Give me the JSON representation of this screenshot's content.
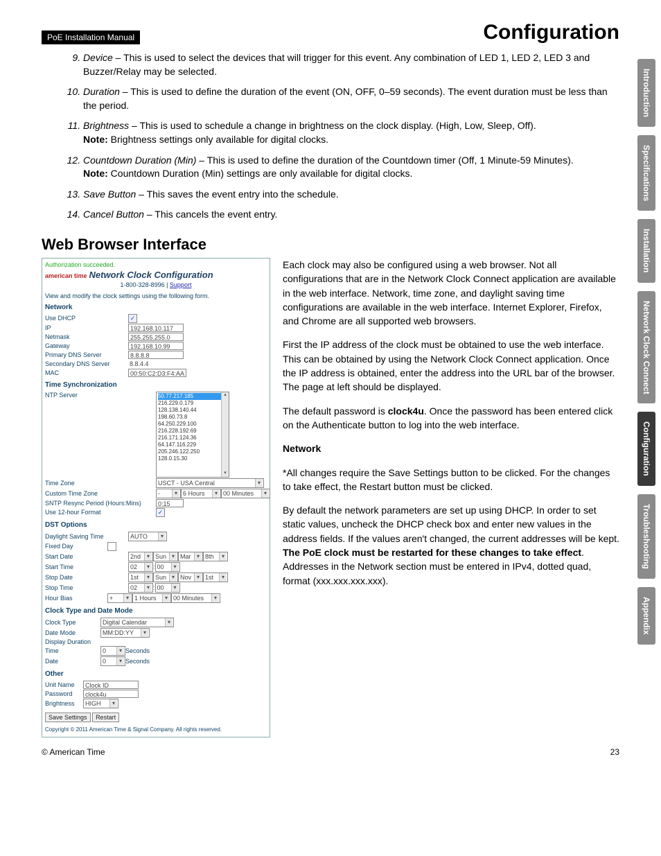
{
  "header": {
    "manual_tag": "PoE Installation Manual",
    "page_title": "Configuration"
  },
  "list": {
    "start": 9,
    "items": [
      {
        "term": "Device",
        "body": " – This is used to select the devices that will trigger for this event. Any combination of LED 1, LED 2, LED 3 and Buzzer/Relay may be selected."
      },
      {
        "term": "Duration",
        "body": " – This is used to define the duration of the event (ON, OFF, 0–59 seconds). The event duration must be less than the period."
      },
      {
        "term": "Brightness",
        "body": " – This is used to schedule a change in brightness on the clock display. (High, Low, Sleep, Off).",
        "note": "Brightness settings only available for digital clocks."
      },
      {
        "term": "Countdown Duration (Min)",
        "body": " – This is used to define the duration of the Countdown timer (Off, 1 Minute-59 Minutes).",
        "note": "Countdown Duration (Min) settings are only available for digital clocks."
      },
      {
        "term": "Save Button",
        "body": " – This saves the event entry into the schedule."
      },
      {
        "term": "Cancel Button",
        "body": " – This cancels the event entry."
      }
    ],
    "note_label": "Note:"
  },
  "section_heading": "Web Browser Interface",
  "screenshot": {
    "auth": "Authorization succeeded.",
    "brand_logo": "american time",
    "brand_title": "Network Clock Configuration",
    "support": "1-800-328-8996 | ",
    "support_link": "Support",
    "desc": "View and modify the clock settings using the following form.",
    "sec_network": "Network",
    "net": {
      "use_dhcp_label": "Use DHCP",
      "use_dhcp_check": "✓",
      "ip_label": "IP",
      "ip": "192.168.10.117",
      "netmask_label": "Netmask",
      "netmask": "255.255.255.0",
      "gateway_label": "Gateway",
      "gateway": "192.168.10.99",
      "pdns_label": "Primary DNS Server",
      "pdns": "8.8.8.8",
      "sdns_label": "Secondary DNS Server",
      "sdns": "8.8.4.4",
      "mac_label": "MAC",
      "mac": "00:50:C2:D3:F4:AA"
    },
    "sec_time": "Time Synchronization",
    "time": {
      "ntp_label": "NTP Server",
      "ntp_list": [
        "50.77.217.185",
        "216.229.0.179",
        "128.138.140.44",
        "198.60.73.8",
        "64.250.229.100",
        "216.228.192.69",
        "216.171.124.36",
        "64.147.116.229",
        "205.246.122.250",
        "128.0.15.30"
      ],
      "tz_label": "Time Zone",
      "tz": "USCT - USA Central",
      "ctz_label": "Custom Time Zone",
      "ctz_sign": "-",
      "ctz_hours": "6 Hours",
      "ctz_mins": "00 Minutes",
      "resync_label": "SNTP Resync Period (Hours:Mins)",
      "resync": "0:15",
      "h12_label": "Use 12-hour Format",
      "h12_check": "✓"
    },
    "sec_dst": "DST Options",
    "dst": {
      "dst_label": "Daylight Saving Time",
      "dst_mode": "AUTO",
      "fixed_label": "Fixed Day",
      "start_date_label": "Start Date",
      "sd1": "2nd",
      "sd2": "Sun",
      "sd3": "Mar",
      "sd4": "8th",
      "start_time_label": "Start Time",
      "st1": "02",
      "st2": "00",
      "stop_date_label": "Stop Date",
      "ed1": "1st",
      "ed2": "Sun",
      "ed3": "Nov",
      "ed4": "1st",
      "stop_time_label": "Stop Time",
      "et1": "02",
      "et2": "00",
      "hour_bias_label": "Hour Bias",
      "hb1": "+",
      "hb2": "1 Hours",
      "hb3": "00 Minutes"
    },
    "sec_clock": "Clock Type and Date Mode",
    "clock": {
      "type_label": "Clock Type",
      "type": "Digital Calendar",
      "mode_label": "Date Mode",
      "mode": "MM:DD:YY",
      "disp_label": "Display Duration",
      "time_label": "Time",
      "time_val": "0",
      "time_unit": "Seconds",
      "date_label": "Date",
      "date_val": "0",
      "date_unit": "Seconds"
    },
    "sec_other": "Other",
    "other": {
      "unit_label": "Unit Name",
      "unit": "Clock ID",
      "pw_label": "Password",
      "pw": "clock4u",
      "bright_label": "Brightness",
      "bright": "HIGH"
    },
    "btn_save": "Save Settings",
    "btn_restart": "Restart",
    "copyright": "Copyright © 2011 American Time & Signal Company. All rights reserved."
  },
  "paras": {
    "p1": "Each clock may also be configured using a web browser. Not all configurations that are in the Network Clock Connect application are available in the web interface. Network, time zone, and daylight saving time configurations are available in the web interface. Internet Explorer, Firefox, and Chrome are all supported web browsers.",
    "p2": "First the IP address of the clock must be obtained to use the web interface. This can be obtained by using the Network Clock Connect application. Once the IP address is obtained, enter the address into the URL bar of the browser. The page at left should be displayed.",
    "p3a": "The default password is ",
    "p3b": "clock4u",
    "p3c": ". Once the password has been entered click on the Authenticate button to log into the web interface.",
    "net_h": "Network",
    "p4": "*All changes require the Save Settings button to be clicked. For the changes to take effect, the Restart button must be clicked.",
    "p5a": "By default the network parameters are set up using DHCP. In order to set static values, uncheck the DHCP check box and enter new values in the address fields. If the values aren't changed, the current addresses will be kept. ",
    "p5b": "The PoE clock must be restarted for these changes to take effect",
    "p5c": ". Addresses in the Network section must be entered in IPv4, dotted quad, format (xxx.xxx.xxx.xxx)."
  },
  "tabs": [
    "Introduction",
    "Specifications",
    "Installation",
    "Network Clock Connect",
    "Configuration",
    "Troubleshooting",
    "Appendix"
  ],
  "active_tab": 4,
  "footer": {
    "copyright": "© American Time",
    "page": "23"
  }
}
